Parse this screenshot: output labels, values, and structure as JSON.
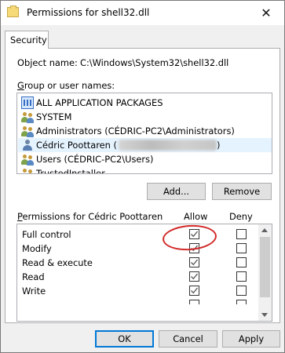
{
  "window": {
    "title": "Permissions for shell32.dll",
    "close_glyph": "✕"
  },
  "tabs": [
    {
      "label": "Security"
    }
  ],
  "object": {
    "label": "Object name:",
    "value": "C:\\Windows\\System32\\shell32.dll"
  },
  "groups": {
    "label_prefix": "G",
    "label_rest": "roup or user names:",
    "items": [
      {
        "label": "ALL APPLICATION PACKAGES",
        "icon": "package-icon"
      },
      {
        "label": "SYSTEM",
        "icon": "group-icon"
      },
      {
        "label": "Administrators (CÉDRIC-PC2\\Administrators)",
        "icon": "group-icon"
      },
      {
        "label": "Cédric Poottaren (",
        "label_end": ")",
        "icon": "user-icon",
        "selected": true
      },
      {
        "label": "Users (CÉDRIC-PC2\\Users)",
        "icon": "group-icon"
      },
      {
        "label": "TrustedInstaller",
        "icon": "group-icon"
      }
    ]
  },
  "buttons": {
    "add": "Add...",
    "remove": "Remove",
    "ok": "OK",
    "cancel": "Cancel",
    "apply": "Apply"
  },
  "permissions": {
    "label_prefix": "P",
    "label_rest": "ermissions for Cédric Poottaren",
    "allow_header": "Allow",
    "deny_header": "Deny",
    "rows": [
      {
        "name": "Full control",
        "allow": true,
        "deny": false
      },
      {
        "name": "Modify",
        "allow": true,
        "deny": false
      },
      {
        "name": "Read & execute",
        "allow": true,
        "deny": false
      },
      {
        "name": "Read",
        "allow": true,
        "deny": false
      },
      {
        "name": "Write",
        "allow": true,
        "deny": false
      }
    ]
  },
  "colors": {
    "annotation": "#d22a2a",
    "accent": "#0078d7"
  }
}
